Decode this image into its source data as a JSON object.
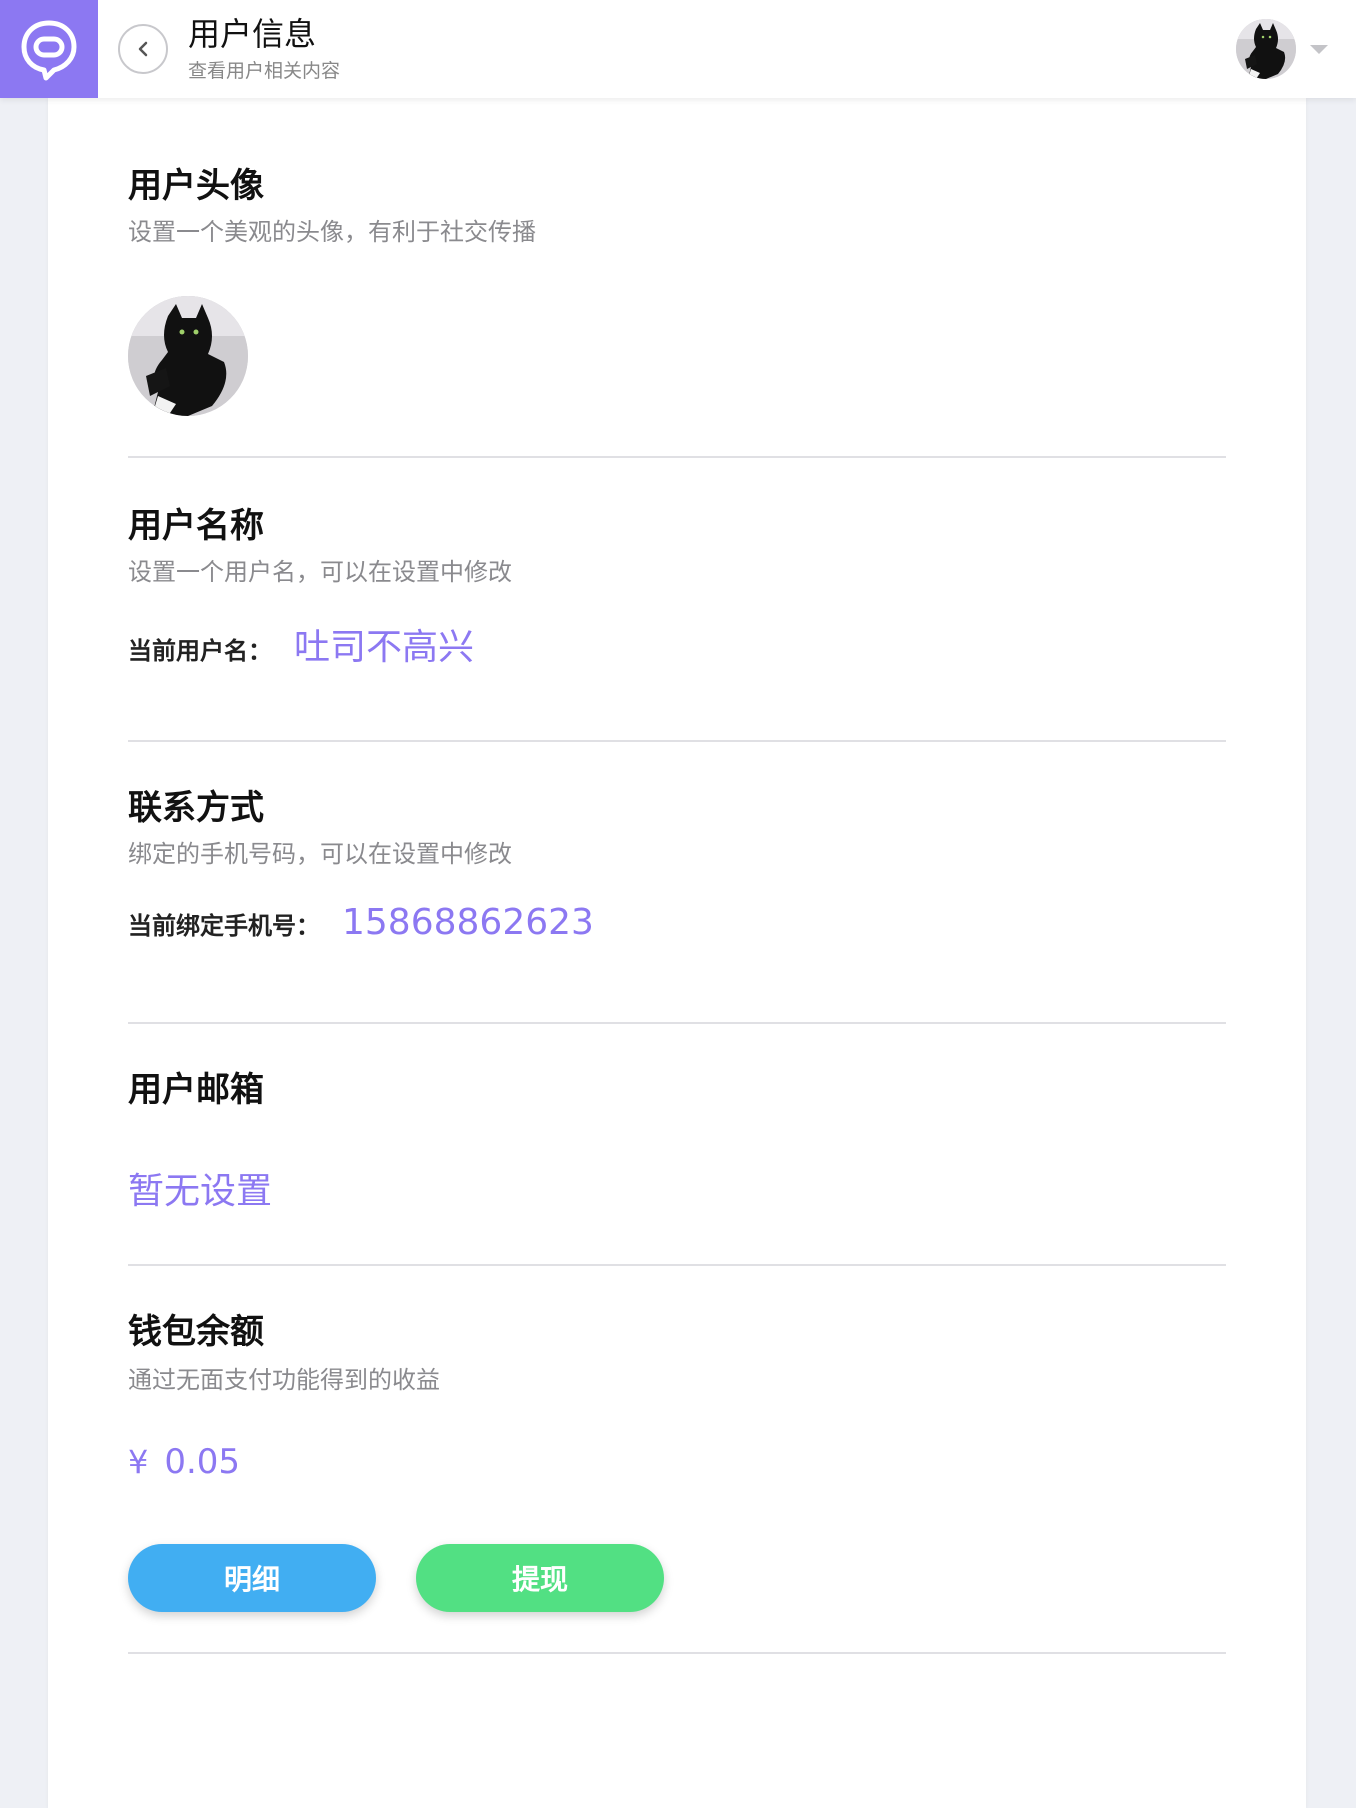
{
  "header": {
    "title": "用户信息",
    "subtitle": "查看用户相关内容"
  },
  "sections": {
    "avatar": {
      "title": "用户头像",
      "desc": "设置一个美观的头像，有利于社交传播"
    },
    "username": {
      "title": "用户名称",
      "desc": "设置一个用户名，可以在设置中修改",
      "label": "当前用户名：",
      "value": "吐司不高兴"
    },
    "contact": {
      "title": "联系方式",
      "desc": "绑定的手机号码，可以在设置中修改",
      "label": "当前绑定手机号：",
      "value": "15868862623"
    },
    "email": {
      "title": "用户邮箱",
      "value": "暂无设置"
    },
    "wallet": {
      "title": "钱包余额",
      "desc": "通过无面支付功能得到的收益",
      "currency": "¥",
      "balance": "0.05",
      "details_button": "明细",
      "withdraw_button": "提现"
    }
  },
  "colors": {
    "accent": "#8c78f2",
    "details_button": "#41aef2",
    "withdraw_button": "#52e083"
  },
  "icons": {
    "logo": "chat-bubble-icon",
    "back": "chevron-left-icon",
    "menu": "caret-down-icon"
  }
}
